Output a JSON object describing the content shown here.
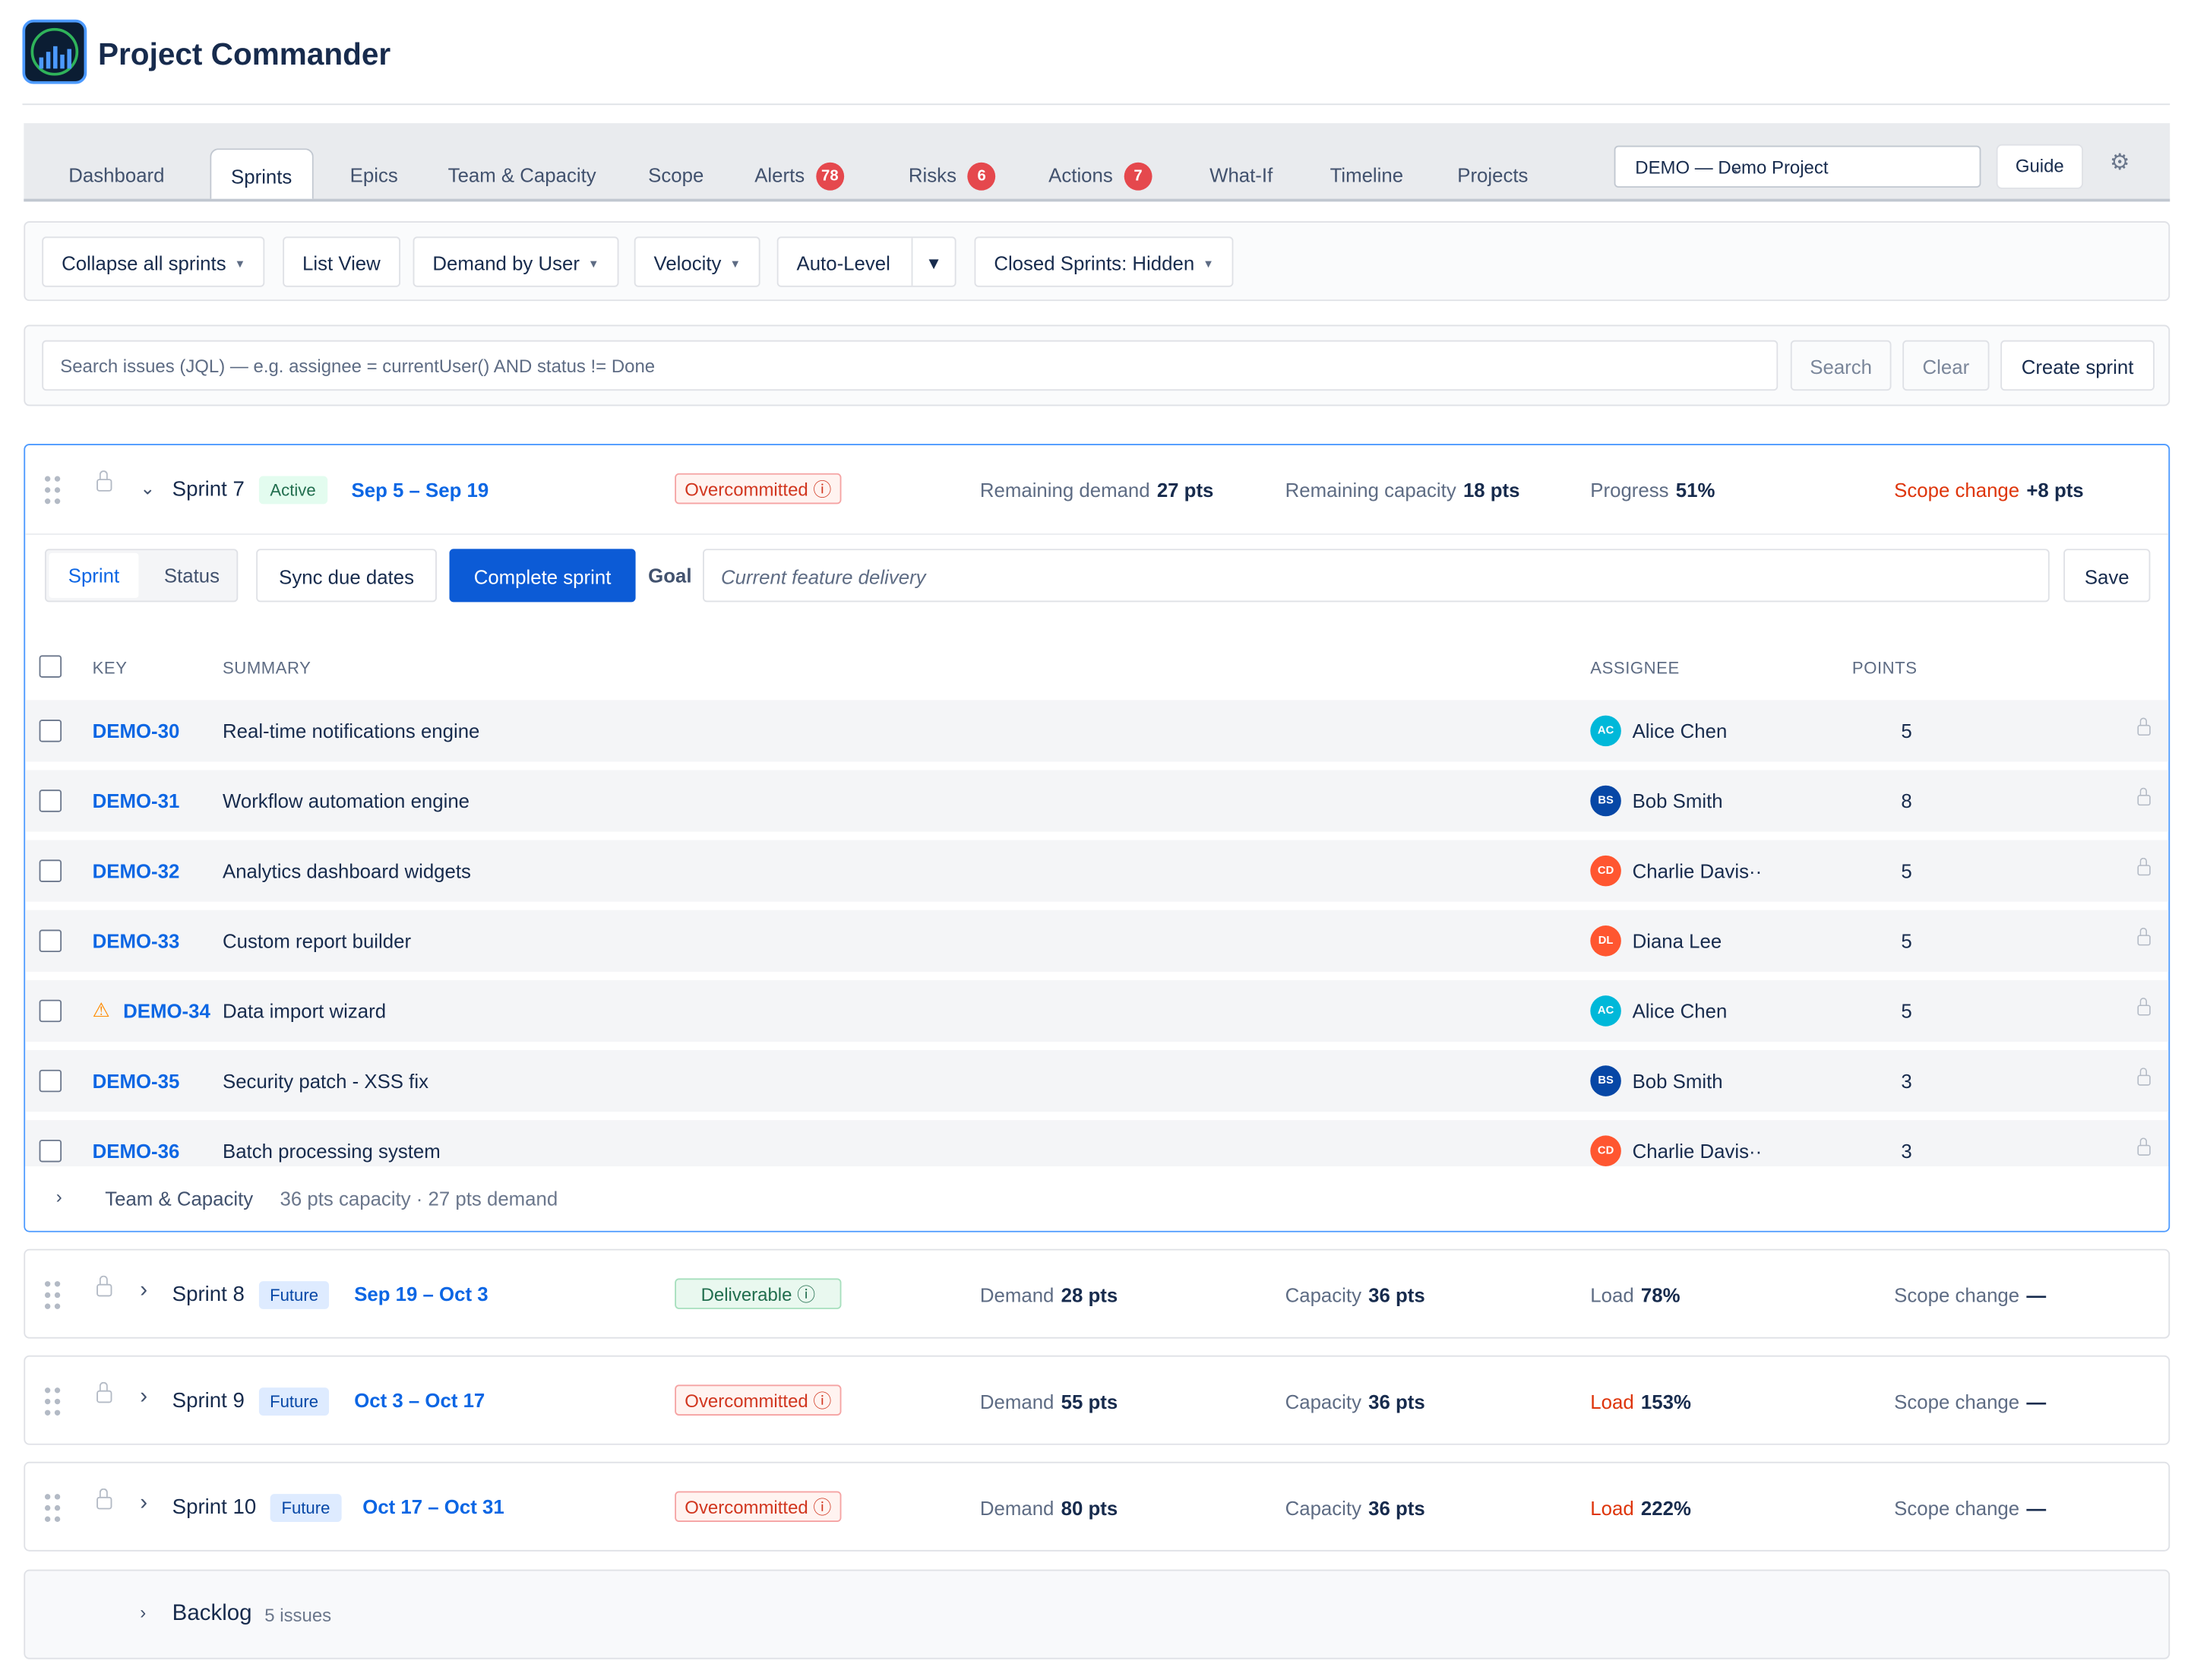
{
  "app": {
    "title": "Project Commander"
  },
  "tabs": [
    {
      "label": "Dashboard"
    },
    {
      "label": "Sprints",
      "active": true
    },
    {
      "label": "Epics"
    },
    {
      "label": "Team & Capacity"
    },
    {
      "label": "Scope"
    },
    {
      "label": "Alerts",
      "badge": "78"
    },
    {
      "label": "Risks",
      "badge": "6"
    },
    {
      "label": "Actions",
      "badge": "7"
    },
    {
      "label": "What-If"
    },
    {
      "label": "Timeline"
    },
    {
      "label": "Projects"
    }
  ],
  "project_select": {
    "value": "DEMO — Demo Project"
  },
  "header_actions": {
    "guide": "Guide",
    "settings_icon": "gear-icon"
  },
  "toolbar": {
    "collapse": "Collapse all sprints",
    "list_view": "List View",
    "demand": "Demand by User",
    "velocity": "Velocity",
    "auto_level": "Auto-Level",
    "closed": "Closed Sprints: Hidden"
  },
  "search": {
    "placeholder": "Search issues (JQL) — e.g. assignee = currentUser() AND status != Done",
    "search_btn": "Search",
    "clear_btn": "Clear",
    "create_btn": "Create sprint"
  },
  "sprint7": {
    "name": "Sprint 7",
    "state": "Active",
    "dates": "Sep 5 – Sep 19",
    "status": "Overcommitted ⓘ",
    "remaining_demand_label": "Remaining demand",
    "remaining_demand": "27 pts",
    "remaining_capacity_label": "Remaining capacity",
    "remaining_capacity": "18 pts",
    "progress_label": "Progress",
    "progress": "51%",
    "scope_label": "Scope change",
    "scope": "+8 pts",
    "view_sprint": "Sprint",
    "view_status": "Status",
    "sync_btn": "Sync due dates",
    "complete_btn": "Complete sprint",
    "goal_label": "Goal",
    "goal_value": "Current feature delivery",
    "save_btn": "Save",
    "columns": {
      "key": "KEY",
      "summary": "SUMMARY",
      "assignee": "ASSIGNEE",
      "points": "POINTS"
    },
    "issues": [
      {
        "key": "DEMO-30",
        "summary": "Real-time notifications engine",
        "initials": "AC",
        "assignee": "Alice Chen",
        "points": "5",
        "color": "#00b8d9"
      },
      {
        "key": "DEMO-31",
        "summary": "Workflow automation engine",
        "initials": "BS",
        "assignee": "Bob Smith",
        "points": "8",
        "color": "#0747a6"
      },
      {
        "key": "DEMO-32",
        "summary": "Analytics dashboard widgets",
        "initials": "CD",
        "assignee": "Charlie Davis··",
        "points": "5",
        "color": "#ff5630"
      },
      {
        "key": "DEMO-33",
        "summary": "Custom report builder",
        "initials": "DL",
        "assignee": "Diana Lee",
        "points": "5",
        "color": "#ff5630"
      },
      {
        "key": "DEMO-34",
        "summary": "Data import wizard",
        "initials": "AC",
        "assignee": "Alice Chen",
        "points": "5",
        "color": "#00b8d9",
        "warning": true
      },
      {
        "key": "DEMO-35",
        "summary": "Security patch - XSS fix",
        "initials": "BS",
        "assignee": "Bob Smith",
        "points": "3",
        "color": "#0747a6"
      },
      {
        "key": "DEMO-36",
        "summary": "Batch processing system",
        "initials": "CD",
        "assignee": "Charlie Davis··",
        "points": "3",
        "color": "#ff5630"
      }
    ],
    "team_capacity_label": "Team & Capacity",
    "team_capacity_detail": "36 pts capacity · 27 pts demand"
  },
  "future_sprints": [
    {
      "name": "Sprint 8",
      "state": "Future",
      "dates": "Sep 19 – Oct 3",
      "status": "Deliverable ⓘ",
      "status_type": "ok",
      "demand_label": "Demand",
      "demand": "28 pts",
      "capacity_label": "Capacity",
      "capacity": "36 pts",
      "load_label": "Load",
      "load": "78%",
      "load_red": false,
      "scope_label": "Scope change",
      "scope": "—"
    },
    {
      "name": "Sprint 9",
      "state": "Future",
      "dates": "Oct 3 – Oct 17",
      "status": "Overcommitted ⓘ",
      "status_type": "over",
      "demand_label": "Demand",
      "demand": "55 pts",
      "capacity_label": "Capacity",
      "capacity": "36 pts",
      "load_label": "Load",
      "load": "153%",
      "load_red": true,
      "scope_label": "Scope change",
      "scope": "—"
    },
    {
      "name": "Sprint 10",
      "state": "Future",
      "dates": "Oct 17 – Oct 31",
      "status": "Overcommitted ⓘ",
      "status_type": "over",
      "demand_label": "Demand",
      "demand": "80 pts",
      "capacity_label": "Capacity",
      "capacity": "36 pts",
      "load_label": "Load",
      "load": "222%",
      "load_red": true,
      "scope_label": "Scope change",
      "scope": "—"
    }
  ],
  "backlog": {
    "label": "Backlog",
    "count": "5 issues"
  }
}
